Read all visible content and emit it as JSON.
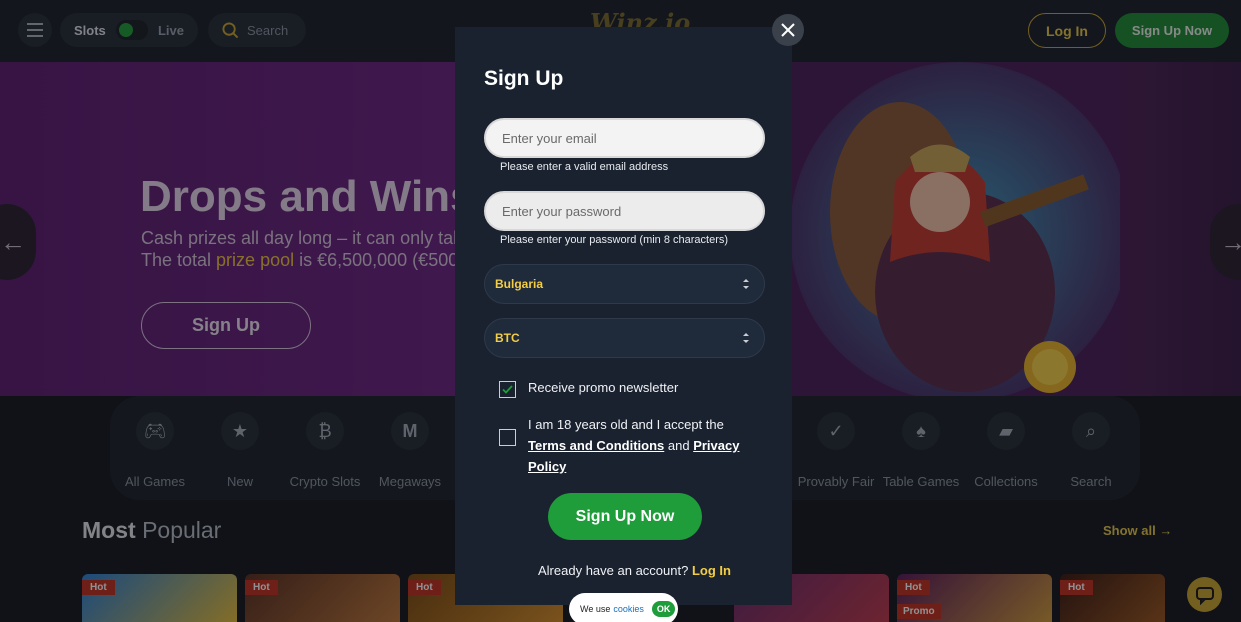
{
  "header": {
    "menu_icon": "hamburger-icon",
    "toggle": {
      "left": "Slots",
      "right": "Live"
    },
    "search_label": "Search",
    "logo_text": "Winz.io",
    "login_label": "Log In",
    "signup_label": "Sign Up Now"
  },
  "hero": {
    "title": "Drops and Wins",
    "line1": "Cash prizes all day long – it can only take",
    "line2_pre": "The total ",
    "line2_gold": "prize pool",
    "line2_post": " is €6,500,000 (€500",
    "signup_label": "Sign Up",
    "prev_icon": "arrow-left-icon",
    "next_icon": "arrow-right-icon"
  },
  "categories": [
    {
      "label": "All Games",
      "icon": "gamepad-icon"
    },
    {
      "label": "New",
      "icon": "star-icon"
    },
    {
      "label": "Crypto Slots",
      "icon": "bitcoin-icon"
    },
    {
      "label": "Megaways",
      "icon": "megaways-icon"
    },
    {
      "label": "Provably Fair",
      "icon": "check-circle-icon"
    },
    {
      "label": "Table Games",
      "icon": "spade-icon"
    },
    {
      "label": "Collections",
      "icon": "folder-icon"
    },
    {
      "label": "Search",
      "icon": "search-icon"
    }
  ],
  "popular": {
    "title_bold": "Most",
    "title_rest": "Popular",
    "show_all": "Show all →",
    "tiles": [
      {
        "badge": "Hot"
      },
      {
        "badge": "Hot"
      },
      {
        "badge": "Hot"
      },
      {
        "badge": ""
      },
      {
        "badge": "Hot",
        "badge2": "Promo"
      },
      {
        "badge": "Hot"
      }
    ]
  },
  "modal": {
    "title": "Sign Up",
    "email_placeholder": "Enter your email",
    "email_hint": "Please enter a valid email address",
    "password_placeholder": "Enter your password",
    "password_hint": "Please enter your password (min 8 characters)",
    "country": "Bulgaria",
    "currency": "BTC",
    "newsletter_label": "Receive promo newsletter",
    "newsletter_checked": true,
    "terms_pre": "I am 18 years old and I accept the ",
    "terms_link": "Terms and Conditions",
    "terms_mid": " and ",
    "privacy_link": "Privacy Policy",
    "terms_checked": false,
    "submit_label": "Sign Up Now",
    "already_text": "Already have an account?",
    "login_link": "Log In"
  },
  "cookie": {
    "text": "We use",
    "link": "cookies",
    "ok": "OK"
  },
  "colors": {
    "accent_gold": "#f3cd44",
    "primary_green": "#1f9d3a",
    "modal_bg": "#1a2230",
    "hero_purple": "#6a2380"
  }
}
